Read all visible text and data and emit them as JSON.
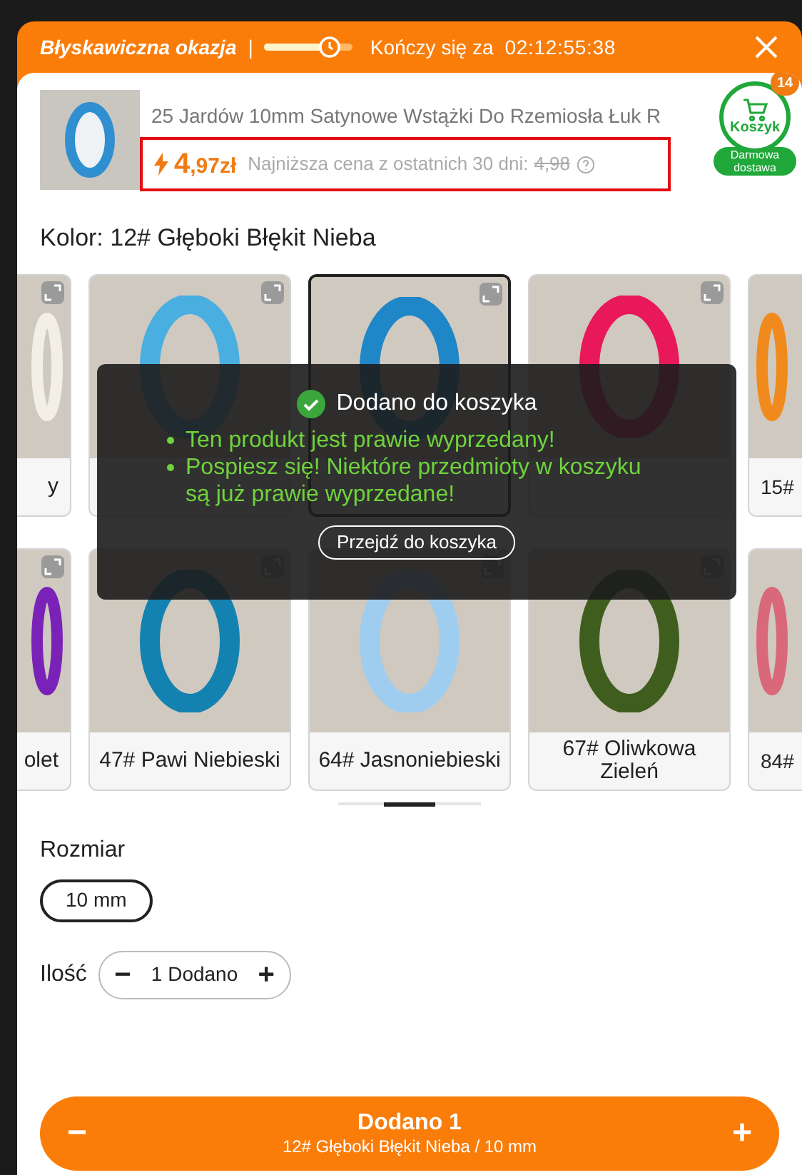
{
  "header": {
    "title": "Błyskawiczna okazja",
    "separator": "|",
    "ends_label": "Kończy się za",
    "countdown": "02:12:55:38"
  },
  "product": {
    "title": "25 Jardów 10mm Satynowe Wstążki Do Rzemiosła Łuk R",
    "price_main": "4",
    "price_fraction": ",97zł",
    "lowest_label": "Najniższa cena z ostatnich 30 dni:",
    "old_price": "4,98"
  },
  "cart": {
    "label": "Koszyk",
    "count": "14",
    "shipping": "Darmowa dostawa"
  },
  "color_label": "Kolor: 12# Głęboki Błękit Nieba",
  "swatch_rows": [
    {
      "items": [
        {
          "kind": "cut_left",
          "label": "y",
          "color": "#f2efe6",
          "selected": false
        },
        {
          "kind": "covered",
          "color": "#49aee0",
          "selected": false
        },
        {
          "kind": "covered",
          "color": "#1f86c8",
          "selected": true
        },
        {
          "kind": "covered",
          "color": "#e8185a",
          "selected": false
        },
        {
          "kind": "cut_right",
          "label": "15#",
          "color": "#f08a1c",
          "selected": false
        }
      ]
    },
    {
      "items": [
        {
          "kind": "cut_left",
          "label": "olet",
          "color": "#7a22b8",
          "selected": false
        },
        {
          "kind": "full",
          "label": "47# Pawi Niebieski",
          "color": "#1482b0",
          "selected": false
        },
        {
          "kind": "full",
          "label": "64# Jasnoniebieski",
          "color": "#9fcdf0",
          "selected": false
        },
        {
          "kind": "full",
          "label": "67# Oliwkowa Zieleń",
          "color": "#3f5e1e",
          "selected": false
        },
        {
          "kind": "cut_right",
          "label": "84#",
          "color": "#d9687a",
          "selected": false
        }
      ]
    }
  ],
  "toast": {
    "title": "Dodano do koszyka",
    "messages": [
      "Ten produkt jest prawie wyprzedany!",
      "Pospiesz się! Niektóre przedmioty w koszyku są już prawie wyprzedane!"
    ],
    "button": "Przejdź do koszyka"
  },
  "size": {
    "label": "Rozmiar",
    "options": [
      {
        "label": "10 mm",
        "selected": true
      }
    ]
  },
  "quantity": {
    "label": "Ilość",
    "minus": "−",
    "value": "1 Dodano",
    "plus": "+"
  },
  "bottom_bar": {
    "minus": "−",
    "title": "Dodano 1",
    "subtitle": "12# Głęboki Błękit Nieba / 10 mm",
    "plus": "+"
  }
}
